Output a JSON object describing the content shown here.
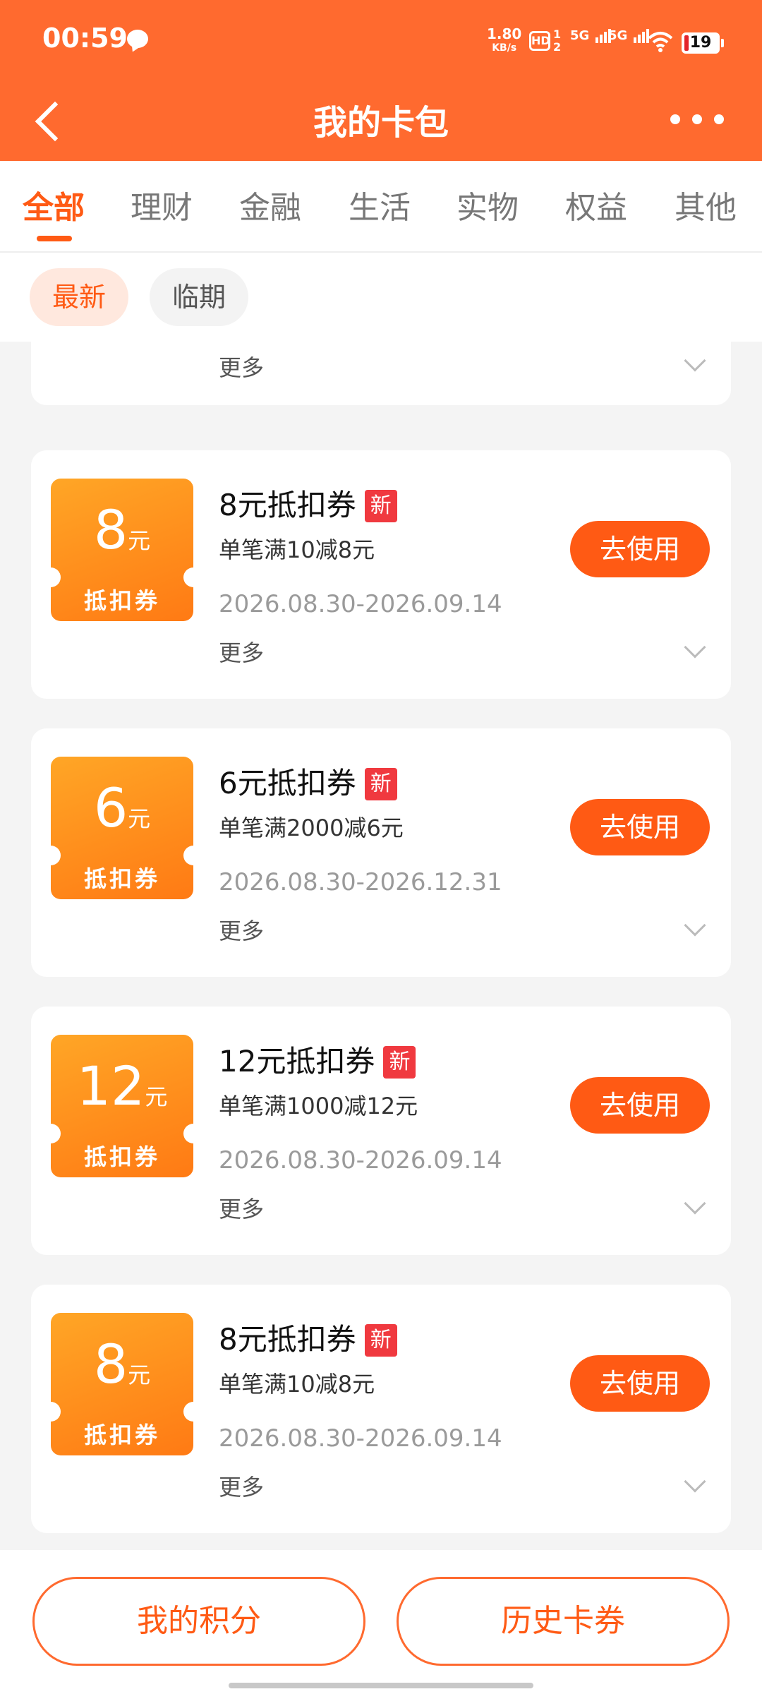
{
  "status": {
    "time": "00:59",
    "net_speed_value": "1.80",
    "net_speed_unit": "KB/s",
    "hd": "HD",
    "hd_sub": "1 2",
    "sim1": "5G",
    "sim2": "5G",
    "battery": "19"
  },
  "nav": {
    "title": "我的卡包"
  },
  "tabs": [
    "全部",
    "理财",
    "金融",
    "生活",
    "实物",
    "权益",
    "其他"
  ],
  "filters": [
    "最新",
    "临期"
  ],
  "more_label": "更多",
  "use_label": "去使用",
  "new_label": "新",
  "coupon_kind": "抵扣券",
  "unit": "元",
  "coupons": [
    {
      "amount": "8",
      "title": "8元抵扣券",
      "desc": "单笔满10减8元",
      "date": "2026.08.30-2026.09.14"
    },
    {
      "amount": "6",
      "title": "6元抵扣券",
      "desc": "单笔满2000减6元",
      "date": "2026.08.30-2026.12.31"
    },
    {
      "amount": "12",
      "title": "12元抵扣券",
      "desc": "单笔满1000减12元",
      "date": "2026.08.30-2026.09.14"
    },
    {
      "amount": "8",
      "title": "8元抵扣券",
      "desc": "单笔满10减8元",
      "date": "2026.08.30-2026.09.14"
    }
  ],
  "bottom": {
    "points": "我的积分",
    "history": "历史卡券"
  },
  "colors": {
    "brand": "#ff6a2f",
    "accent": "#ff5a14",
    "badge": "#f0393f"
  }
}
